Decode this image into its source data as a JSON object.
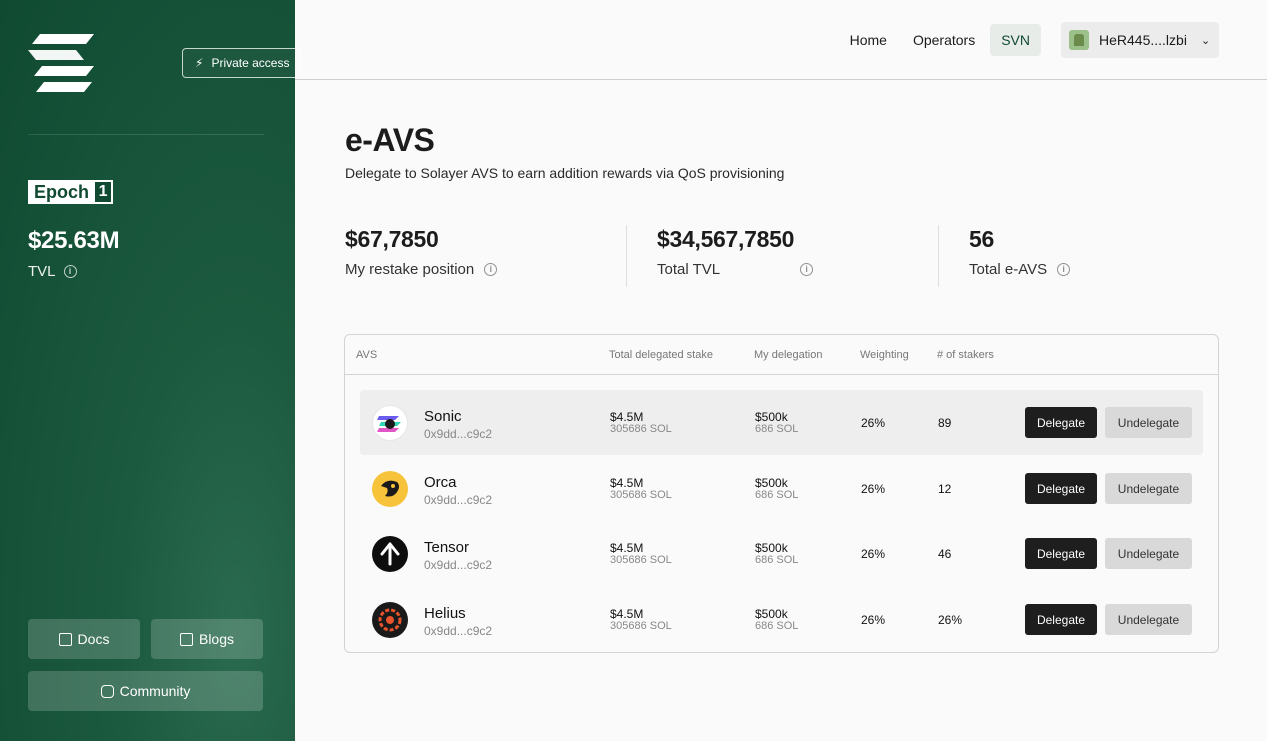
{
  "sidebar": {
    "private_access_label": "Private access",
    "epoch_label": "Epoch",
    "epoch_number": "1",
    "tvl_value": "$25.63M",
    "tvl_label": "TVL",
    "docs_label": "Docs",
    "blogs_label": "Blogs",
    "community_label": "Community"
  },
  "header": {
    "nav": [
      "Home",
      "Operators",
      "SVN"
    ],
    "active_nav": "SVN",
    "wallet_label": "HeR445....lzbi"
  },
  "main": {
    "title": "e-AVS",
    "subtitle": "Delegate to Solayer AVS to earn addition rewards via QoS provisioning",
    "stats": [
      {
        "value": "$67,7850",
        "label": "My restake position"
      },
      {
        "value": "$34,567,7850",
        "label": "Total TVL"
      },
      {
        "value": "56",
        "label": "Total e-AVS"
      }
    ]
  },
  "table": {
    "headers": [
      "AVS",
      "Total delegated stake",
      "My delegation",
      "Weighting",
      "# of stakers"
    ],
    "delegate_label": "Delegate",
    "undelegate_label": "Undelegate",
    "rows": [
      {
        "name": "Sonic",
        "address": "0x9dd...c9c2",
        "total_usd": "$4.5M",
        "total_sol": "305686 SOL",
        "my_usd": "$500k",
        "my_sol": "686 SOL",
        "weighting": "26%",
        "stakers": "89",
        "icon": "sonic-logo-icon"
      },
      {
        "name": "Orca",
        "address": "0x9dd...c9c2",
        "total_usd": "$4.5M",
        "total_sol": "305686 SOL",
        "my_usd": "$500k",
        "my_sol": "686 SOL",
        "weighting": "26%",
        "stakers": "12",
        "icon": "orca-logo-icon"
      },
      {
        "name": "Tensor",
        "address": "0x9dd...c9c2",
        "total_usd": "$4.5M",
        "total_sol": "305686 SOL",
        "my_usd": "$500k",
        "my_sol": "686 SOL",
        "weighting": "26%",
        "stakers": "46",
        "icon": "tensor-logo-icon"
      },
      {
        "name": "Helius",
        "address": "0x9dd...c9c2",
        "total_usd": "$4.5M",
        "total_sol": "305686 SOL",
        "my_usd": "$500k",
        "my_sol": "686 SOL",
        "weighting": "26%",
        "stakers": "26%",
        "icon": "helius-logo-icon"
      }
    ]
  },
  "colors": {
    "sidebar_green": "#0f4a31",
    "active_nav_bg": "#e7ece9",
    "delegate_bg": "#1e1e1e",
    "undelegate_bg": "#d9d9d9"
  }
}
